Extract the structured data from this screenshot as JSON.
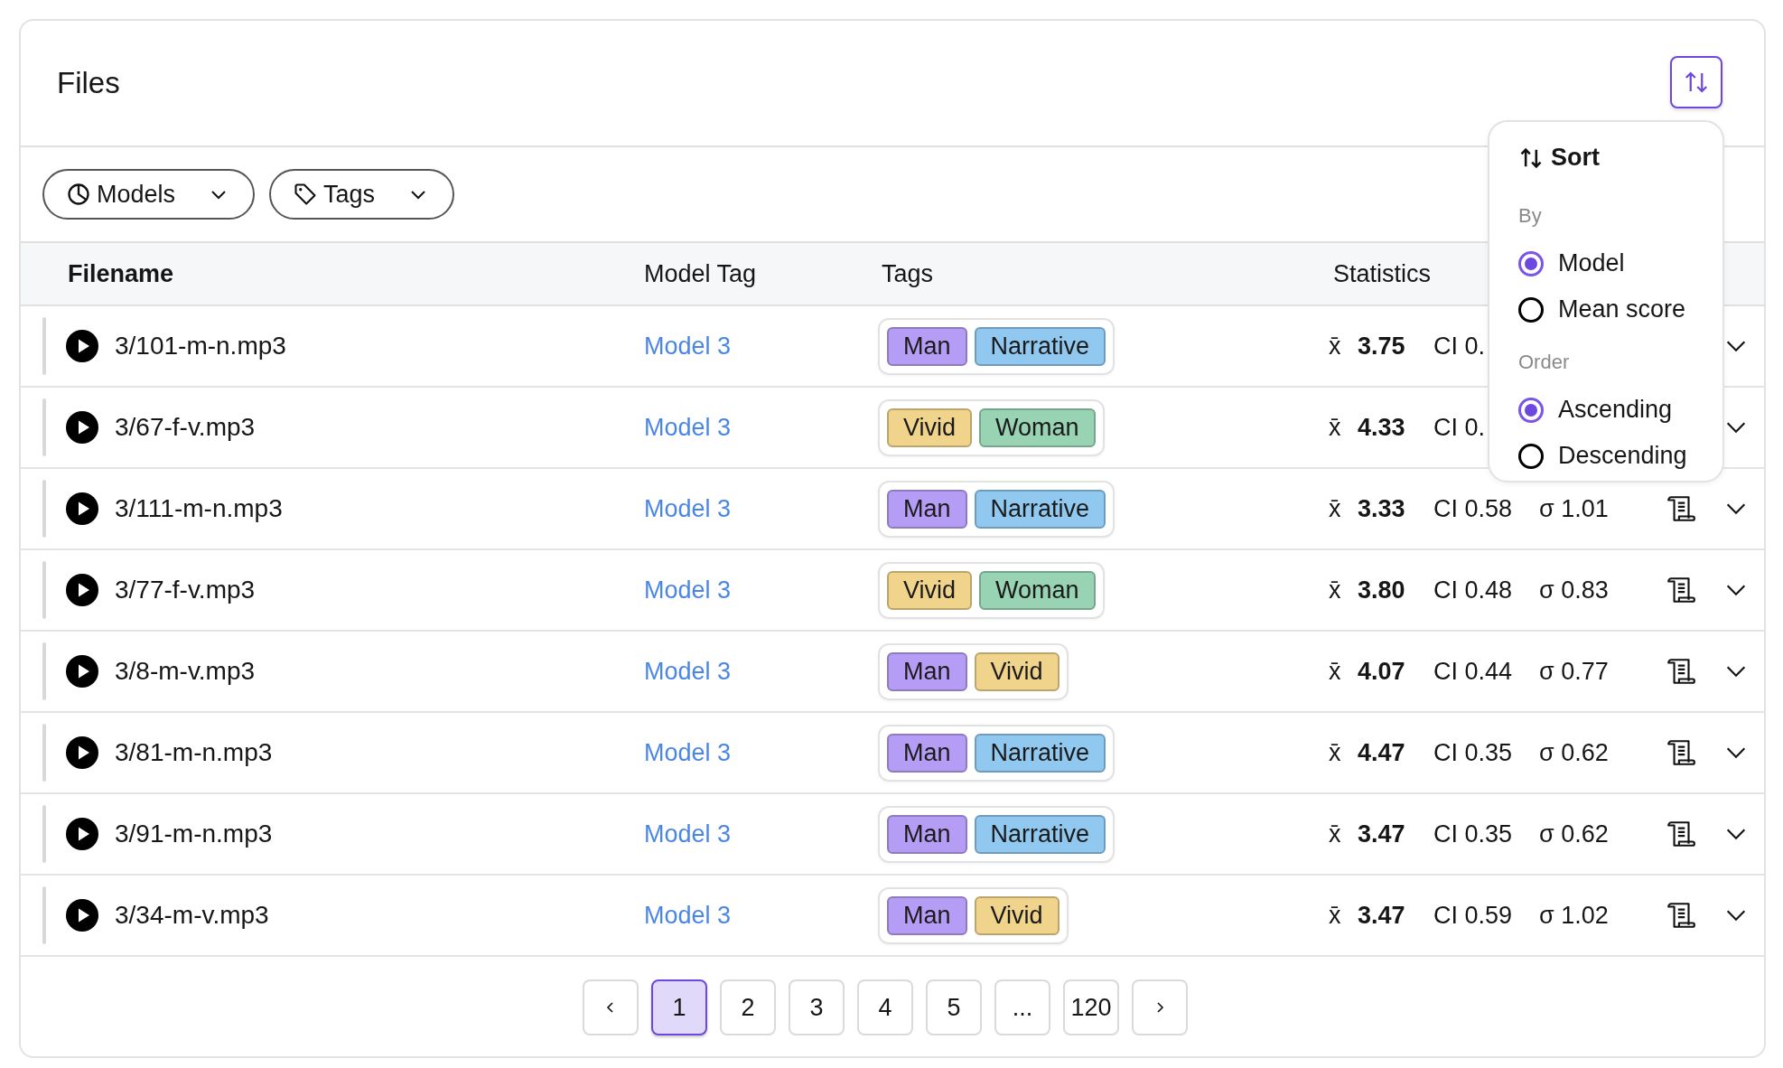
{
  "title": "Files",
  "filters": [
    {
      "kind": "models",
      "label": "Models"
    },
    {
      "kind": "tags",
      "label": "Tags"
    }
  ],
  "columns": [
    "Filename",
    "Model Tag",
    "Tags",
    "Statistics"
  ],
  "rows": [
    {
      "file": "3/101-m-n.mp3",
      "model": "Model 3",
      "tags": [
        {
          "label": "Man",
          "color": "#b59cf5"
        },
        {
          "label": "Narrative",
          "color": "#90c8f0"
        }
      ],
      "mean_label": "x̄",
      "mean": "3.75",
      "ci": "CI 0."
    },
    {
      "file": "3/67-f-v.mp3",
      "model": "Model 3",
      "tags": [
        {
          "label": "Vivid",
          "color": "#f0d48c"
        },
        {
          "label": "Woman",
          "color": "#98d4b4"
        }
      ],
      "mean_label": "x̄",
      "mean": "4.33",
      "ci": "CI 0."
    },
    {
      "file": "3/111-m-n.mp3",
      "model": "Model 3",
      "tags": [
        {
          "label": "Man",
          "color": "#b59cf5"
        },
        {
          "label": "Narrative",
          "color": "#90c8f0"
        }
      ],
      "mean_label": "x̄",
      "mean": "3.33",
      "ci": "CI 0.58",
      "sd": "σ 1.01"
    },
    {
      "file": "3/77-f-v.mp3",
      "model": "Model 3",
      "tags": [
        {
          "label": "Vivid",
          "color": "#f0d48c"
        },
        {
          "label": "Woman",
          "color": "#98d4b4"
        }
      ],
      "mean_label": "x̄",
      "mean": "3.80",
      "ci": "CI 0.48",
      "sd": "σ 0.83"
    },
    {
      "file": "3/8-m-v.mp3",
      "model": "Model 3",
      "tags": [
        {
          "label": "Man",
          "color": "#b59cf5"
        },
        {
          "label": "Vivid",
          "color": "#f0d48c"
        }
      ],
      "mean_label": "x̄",
      "mean": "4.07",
      "ci": "CI 0.44",
      "sd": "σ 0.77"
    },
    {
      "file": "3/81-m-n.mp3",
      "model": "Model 3",
      "tags": [
        {
          "label": "Man",
          "color": "#b59cf5"
        },
        {
          "label": "Narrative",
          "color": "#90c8f0"
        }
      ],
      "mean_label": "x̄",
      "mean": "4.47",
      "ci": "CI 0.35",
      "sd": "σ 0.62"
    },
    {
      "file": "3/91-m-n.mp3",
      "model": "Model 3",
      "tags": [
        {
          "label": "Man",
          "color": "#b59cf5"
        },
        {
          "label": "Narrative",
          "color": "#90c8f0"
        }
      ],
      "mean_label": "x̄",
      "mean": "3.47",
      "ci": "CI 0.35",
      "sd": "σ 0.62"
    },
    {
      "file": "3/34-m-v.mp3",
      "model": "Model 3",
      "tags": [
        {
          "label": "Man",
          "color": "#b59cf5"
        },
        {
          "label": "Vivid",
          "color": "#f0d48c"
        }
      ],
      "mean_label": "x̄",
      "mean": "3.47",
      "ci": "CI 0.59",
      "sd": "σ 1.02"
    }
  ],
  "pagination": [
    {
      "label": "1",
      "selected": true
    },
    {
      "label": "2",
      "selected": false
    },
    {
      "label": "3",
      "selected": false
    },
    {
      "label": "4",
      "selected": false
    },
    {
      "label": "5",
      "selected": false
    },
    {
      "label": "...",
      "selected": false
    },
    {
      "label": "120",
      "selected": false
    }
  ],
  "sort_menu": {
    "title": "Sort",
    "groups": [
      {
        "label": "By",
        "options": [
          {
            "label": "Model",
            "selected": true
          },
          {
            "label": "Mean score",
            "selected": false
          }
        ]
      },
      {
        "label": "Order",
        "options": [
          {
            "label": "Ascending",
            "selected": true
          },
          {
            "label": "Descending",
            "selected": false
          }
        ]
      }
    ]
  }
}
